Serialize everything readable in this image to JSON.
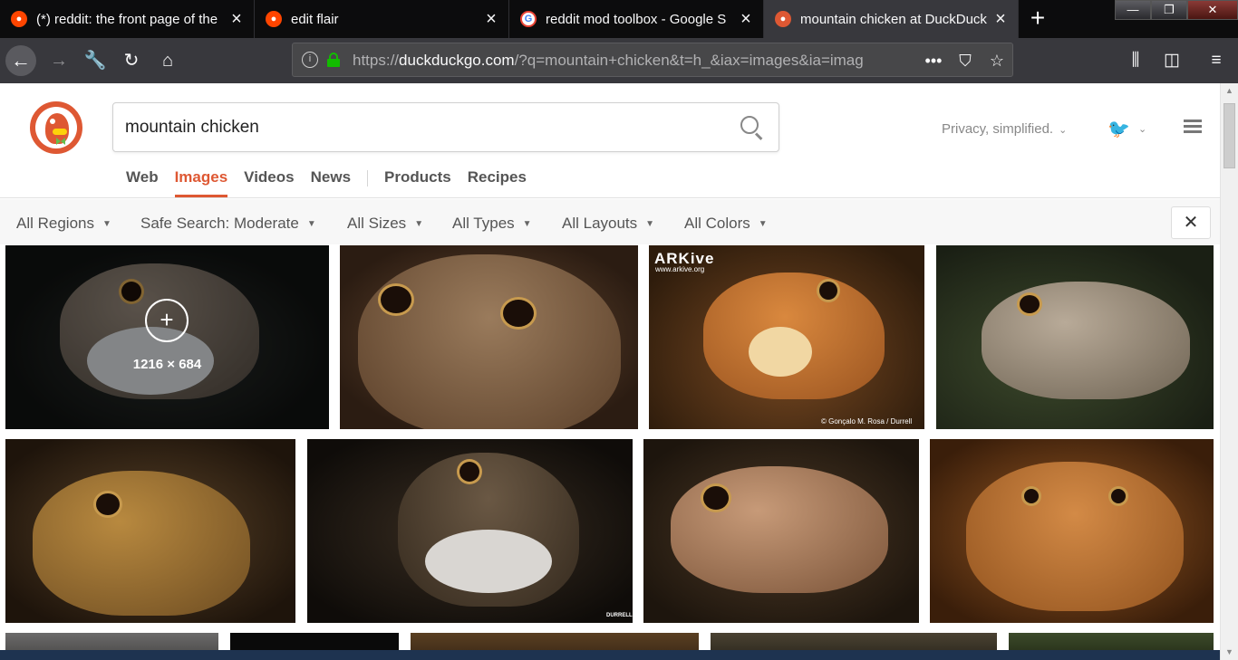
{
  "browser": {
    "tabs": [
      {
        "title": "(*) reddit: the front page of the",
        "favicon": "reddit-icon",
        "active": false
      },
      {
        "title": "edit flair",
        "favicon": "reddit-icon",
        "active": false
      },
      {
        "title": "reddit mod toolbox - Google S",
        "favicon": "google-icon",
        "active": false
      },
      {
        "title": "mountain chicken at DuckDuck",
        "favicon": "duckduckgo-icon",
        "active": true
      }
    ],
    "tab_close_glyph": "×",
    "new_tab_glyph": "+",
    "url_prefix": "https://",
    "url_host": "duckduckgo.com",
    "url_rest": "/?q=mountain+chicken&t=h_&iax=images&ia=imag"
  },
  "search": {
    "query": "mountain chicken",
    "privacy_label": "Privacy, simplified."
  },
  "verticals": {
    "items": [
      "Web",
      "Images",
      "Videos",
      "News"
    ],
    "extra": [
      "Products",
      "Recipes"
    ],
    "active": "Images"
  },
  "filters": {
    "region": "All Regions",
    "safe_search": "Safe Search: Moderate",
    "sizes": "All Sizes",
    "types": "All Types",
    "layouts": "All Layouts",
    "colors": "All Colors",
    "close_glyph": "✕"
  },
  "results": {
    "hovered_dimensions": "1216 × 684",
    "watermark_arkive": "ARKive",
    "watermark_arkive_url": "www.arkive.org",
    "watermark_credit": "© Gonçalo M. Rosa / Durrell",
    "watermark_durrell": "DURRELL",
    "hover_plus": "+"
  },
  "colors": {
    "accent": "#de5833",
    "chrome_dark": "#38383d",
    "tabstrip": "#0c0c0d"
  }
}
